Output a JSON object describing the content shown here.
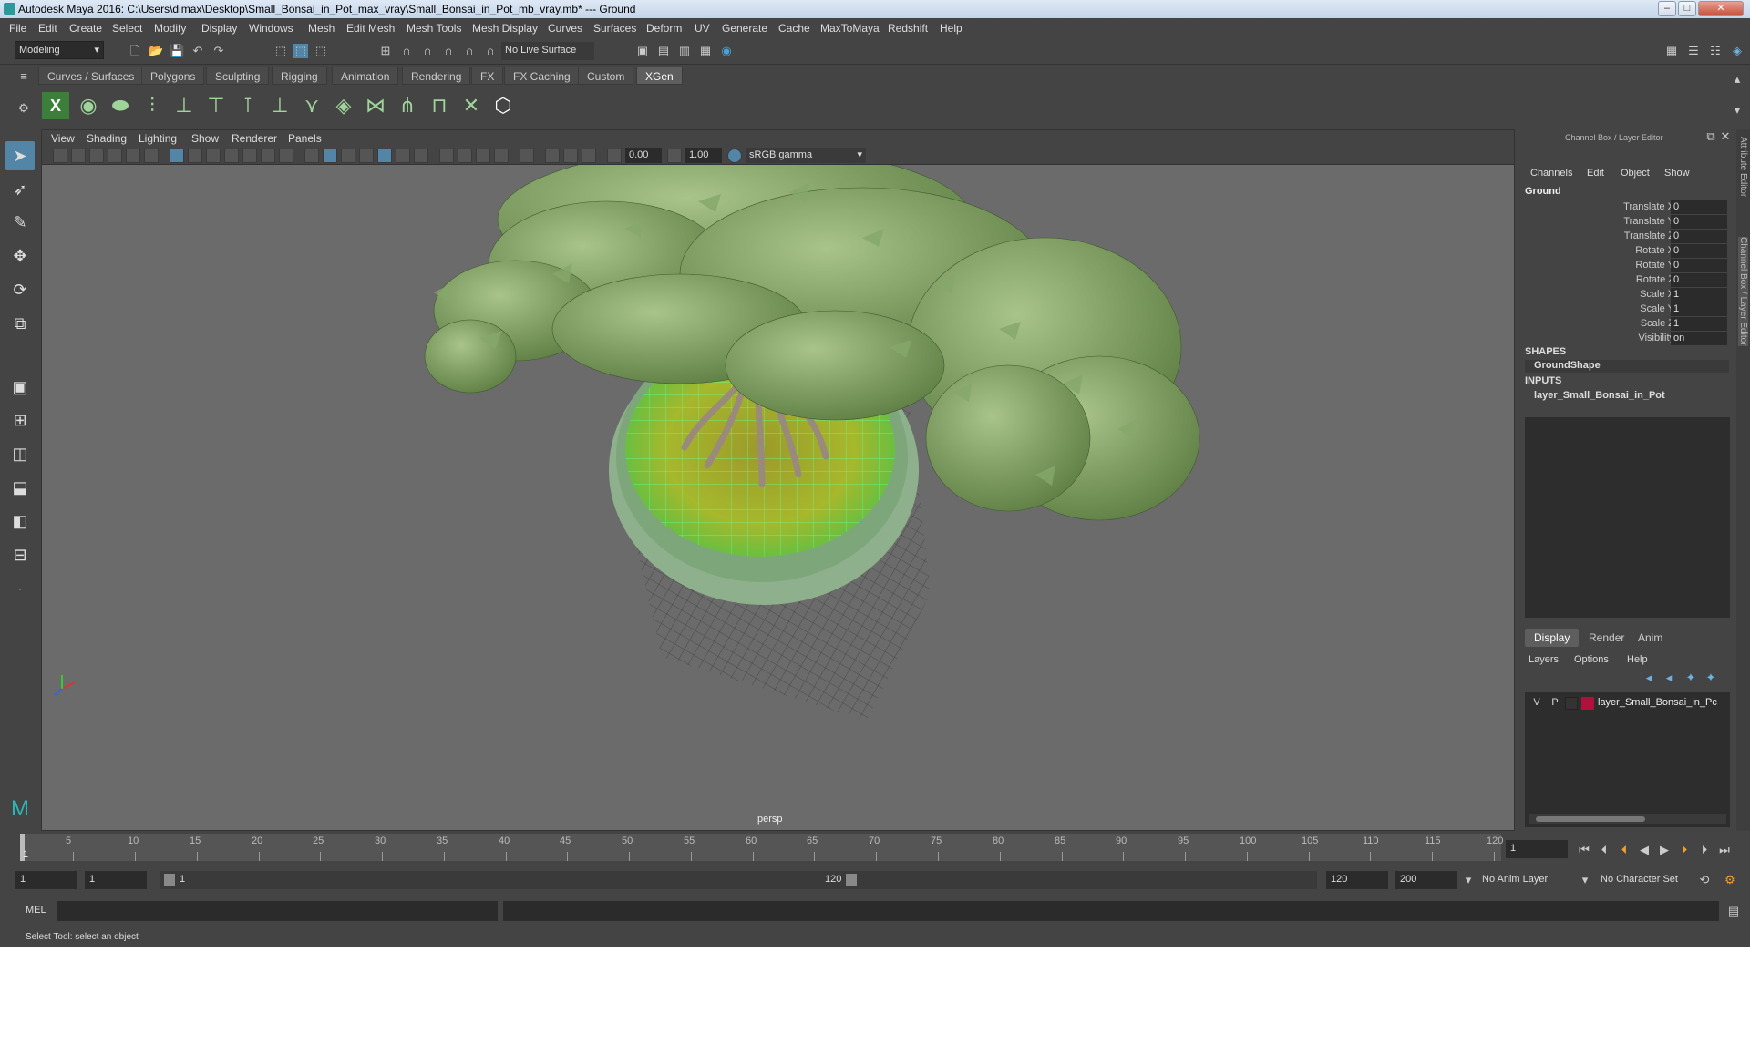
{
  "window": {
    "title": "Autodesk Maya 2016: C:\\Users\\dimax\\Desktop\\Small_Bonsai_in_Pot_max_vray\\Small_Bonsai_in_Pot_mb_vray.mb*   ---   Ground",
    "minimize": "–",
    "maximize": "□",
    "close": "✕"
  },
  "menubar": [
    "File",
    "Edit",
    "Create",
    "Select",
    "Modify",
    "Display",
    "Windows",
    "Mesh",
    "Edit Mesh",
    "Mesh Tools",
    "Mesh Display",
    "Curves",
    "Surfaces",
    "Deform",
    "UV",
    "Generate",
    "Cache",
    "MaxToMaya",
    "Redshift",
    "Help"
  ],
  "statusline": {
    "mode": "Modeling",
    "live_surface": "No Live Surface"
  },
  "shelf": {
    "tabs": [
      "Curves / Surfaces",
      "Polygons",
      "Sculpting",
      "Rigging",
      "Animation",
      "Rendering",
      "FX",
      "FX Caching",
      "Custom",
      "XGen"
    ],
    "active_tab": "XGen"
  },
  "viewport": {
    "menu": [
      "View",
      "Shading",
      "Lighting",
      "Show",
      "Renderer",
      "Panels"
    ],
    "exposure": "0.00",
    "gamma": "1.00",
    "color_space": "sRGB gamma",
    "camera_label": "persp"
  },
  "channel_box": {
    "header": "Channel Box / Layer Editor",
    "menu": [
      "Channels",
      "Edit",
      "Object",
      "Show"
    ],
    "object_name": "Ground",
    "channels": [
      {
        "label": "Translate X",
        "value": "0"
      },
      {
        "label": "Translate Y",
        "value": "0"
      },
      {
        "label": "Translate Z",
        "value": "0"
      },
      {
        "label": "Rotate X",
        "value": "0"
      },
      {
        "label": "Rotate Y",
        "value": "0"
      },
      {
        "label": "Rotate Z",
        "value": "0"
      },
      {
        "label": "Scale X",
        "value": "1"
      },
      {
        "label": "Scale Y",
        "value": "1"
      },
      {
        "label": "Scale Z",
        "value": "1"
      },
      {
        "label": "Visibility",
        "value": "on"
      }
    ],
    "shapes_title": "SHAPES",
    "shape_name": "GroundShape",
    "inputs_title": "INPUTS",
    "input_name": "layer_Small_Bonsai_in_Pot"
  },
  "layer_editor": {
    "tabs": [
      "Display",
      "Render",
      "Anim"
    ],
    "active_tab": "Display",
    "menu": [
      "Layers",
      "Options",
      "Help"
    ],
    "layers": [
      {
        "v": "V",
        "p": "P",
        "color": "#b0103a",
        "name": "layer_Small_Bonsai_in_Pc"
      }
    ]
  },
  "side_tabs": [
    "Attribute Editor",
    "Channel Box / Layer Editor"
  ],
  "timeline": {
    "ticks": [
      "1",
      "5",
      "10",
      "15",
      "20",
      "25",
      "30",
      "35",
      "40",
      "45",
      "50",
      "55",
      "60",
      "65",
      "70",
      "75",
      "80",
      "85",
      "90",
      "95",
      "100",
      "105",
      "110",
      "115",
      "120"
    ],
    "current_frame": "1"
  },
  "range": {
    "start": "1",
    "playback_start": "1",
    "range_start_label": "1",
    "range_end_label": "120",
    "playback_end": "120",
    "end": "200",
    "anim_layer": "No Anim Layer",
    "character_set": "No Character Set"
  },
  "command_line": {
    "label": "MEL"
  },
  "help_line": "Select Tool: select an object"
}
